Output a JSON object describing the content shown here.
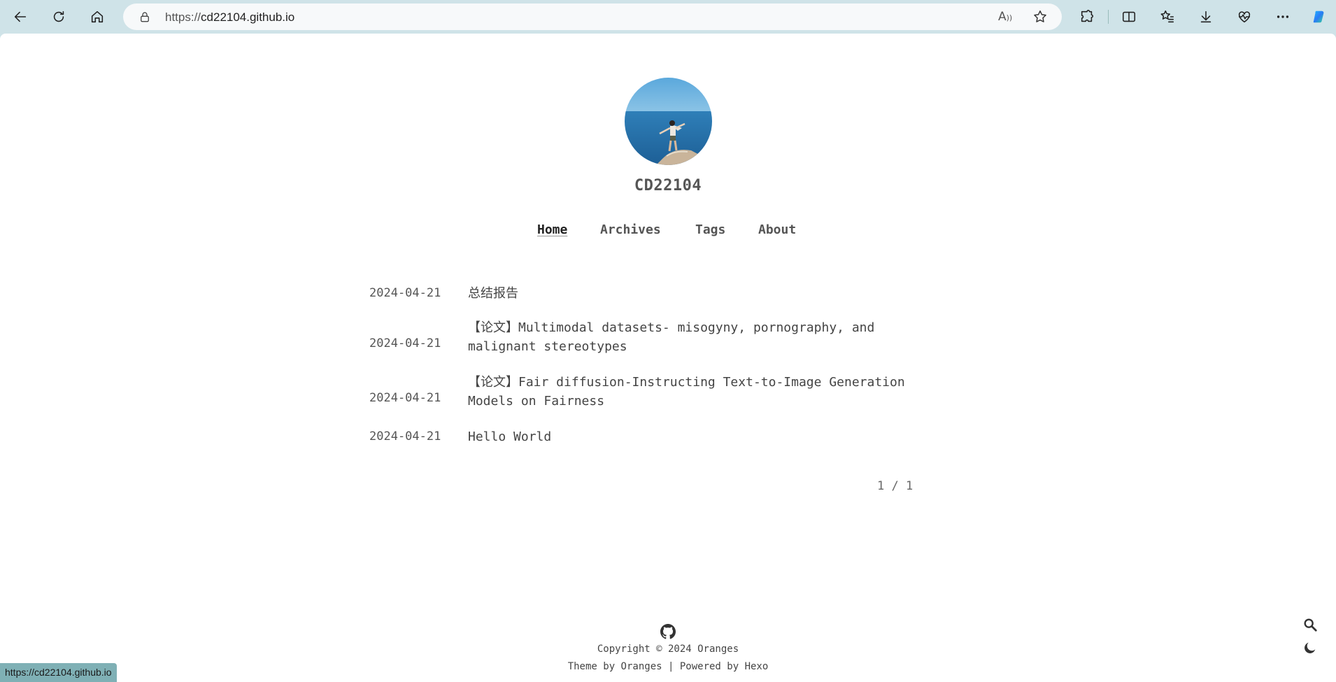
{
  "browser": {
    "url_scheme": "https://",
    "url_host": "cd22104.github.io",
    "status_url": "https://cd22104.github.io",
    "read_aloud_label": "Á"
  },
  "site": {
    "title": "CD22104",
    "nav": [
      {
        "label": "Home",
        "active": true
      },
      {
        "label": "Archives",
        "active": false
      },
      {
        "label": "Tags",
        "active": false
      },
      {
        "label": "About",
        "active": false
      }
    ]
  },
  "posts": [
    {
      "date": "2024-04-21",
      "title": "总结报告"
    },
    {
      "date": "2024-04-21",
      "title": "【论文】Multimodal datasets- misogyny, pornography, and malignant stereotypes"
    },
    {
      "date": "2024-04-21",
      "title": "【论文】Fair diffusion-Instructing Text-to-Image Generation Models on Fairness"
    },
    {
      "date": "2024-04-21",
      "title": "Hello World"
    }
  ],
  "pagination": "1 / 1",
  "footer": {
    "copyright": "Copyright © 2024 Oranges",
    "powered_by": "Theme by Oranges | Powered by Hexo"
  },
  "icons": {
    "back": "back-arrow-icon",
    "refresh": "refresh-icon",
    "home": "home-icon",
    "lock": "lock-icon",
    "favorite": "star-icon",
    "extensions": "puzzle-icon",
    "split": "split-screen-icon",
    "favorites": "favorites-list-icon",
    "downloads": "download-icon",
    "health": "heart-pulse-icon",
    "more": "more-icon",
    "copilot": "copilot-icon",
    "github": "github-icon",
    "search": "search-icon",
    "theme": "moon-icon"
  },
  "colors": {
    "toolbar": "#cfe3e8",
    "page_bg": "#ffffff",
    "text": "#4a4a4a",
    "status_bar": "#7fb0b5"
  }
}
